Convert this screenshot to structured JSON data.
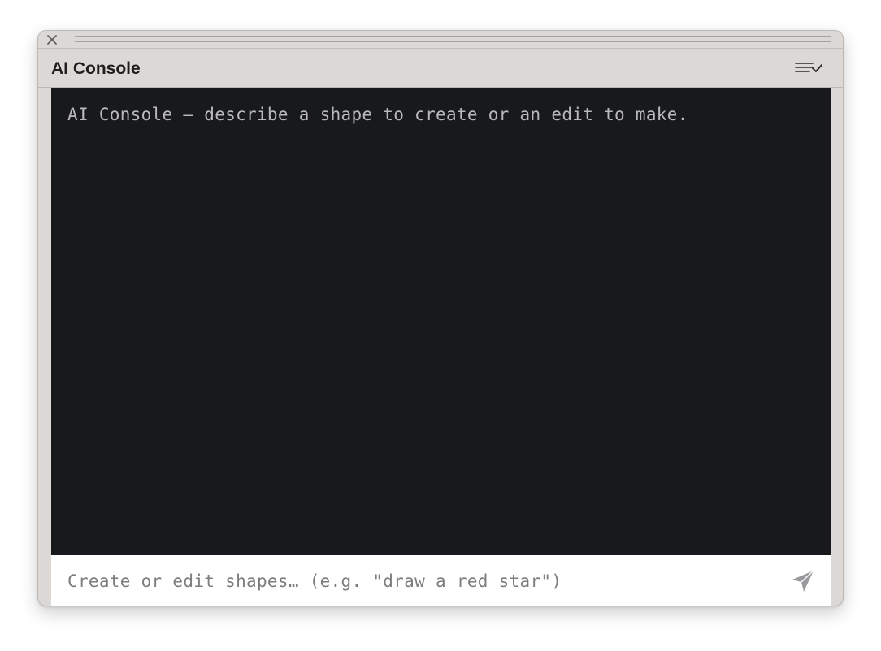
{
  "panel": {
    "title": "AI Console",
    "close_icon": "close-icon",
    "menu_icon": "list-check-icon"
  },
  "console": {
    "lines": [
      "AI Console — describe a shape to create or an edit to make."
    ]
  },
  "input": {
    "value": "",
    "placeholder": "Create or edit shapes… (e.g. \"draw a red star\")",
    "send_icon": "send-icon"
  },
  "colors": {
    "panel_bg": "#dcd8d6",
    "console_bg": "#18191d",
    "console_text": "#b9b9bd",
    "placeholder_text": "#7d7d80"
  }
}
